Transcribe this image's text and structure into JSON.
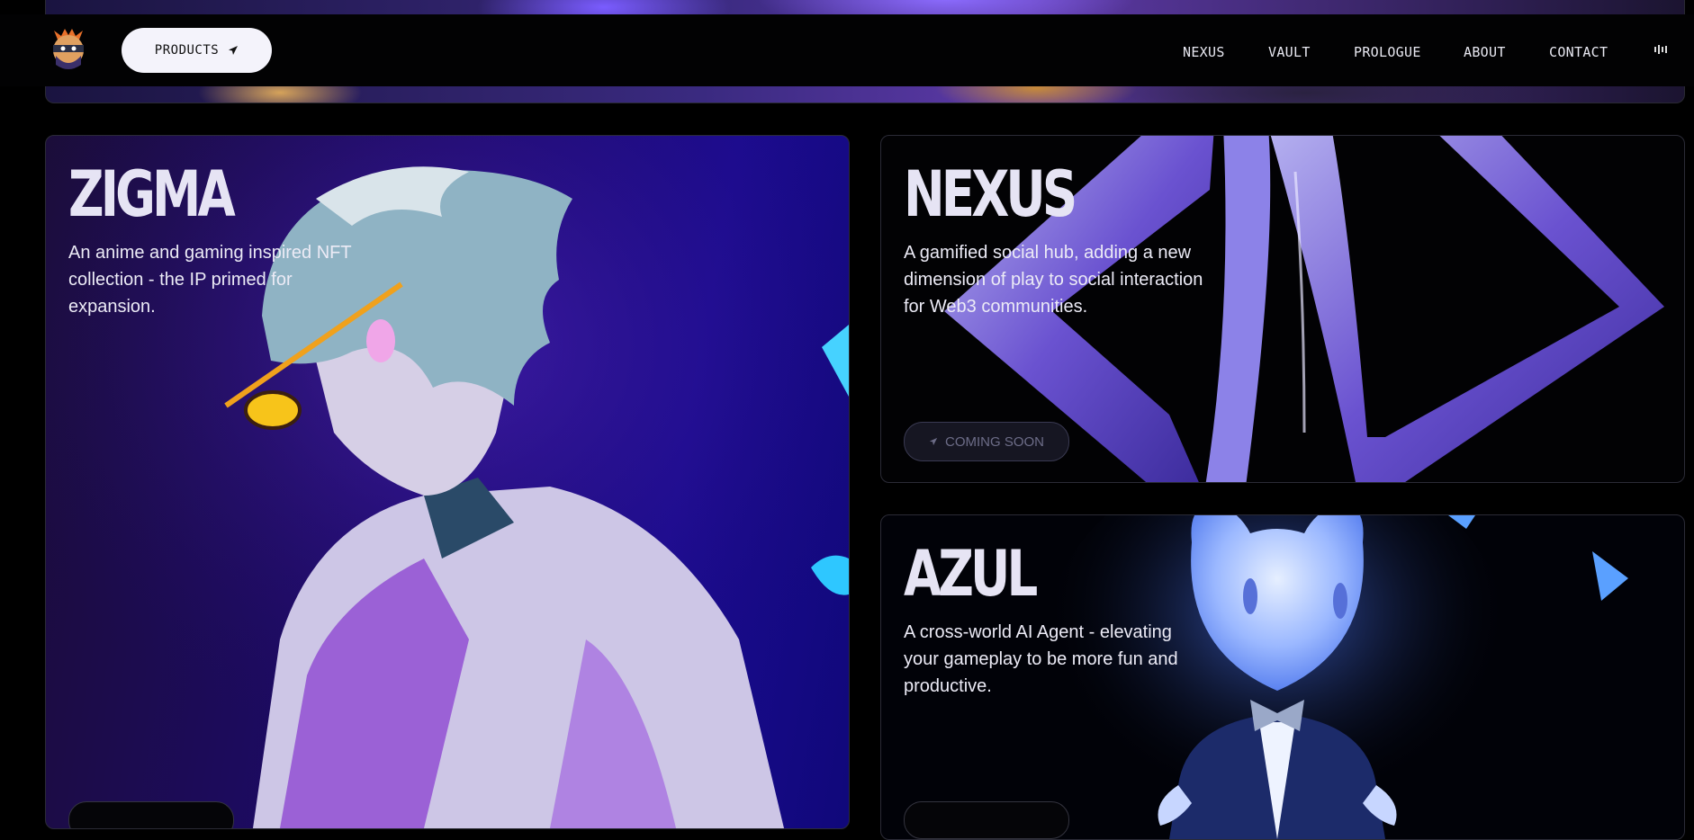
{
  "navbar": {
    "logo_icon": "ninja-mascot-logo-icon",
    "products_label": "PRODUCTS",
    "products_icon": "paper-plane-icon",
    "links": [
      {
        "label": "NEXUS"
      },
      {
        "label": "VAULT"
      },
      {
        "label": "PROLOGUE"
      },
      {
        "label": "ABOUT"
      },
      {
        "label": "CONTACT"
      }
    ],
    "audio_icon": "audio-bars-icon"
  },
  "cards": {
    "zigma": {
      "title": "ZIGMA",
      "description": "An anime and gaming inspired NFT collection - the IP primed for expansion.",
      "art": "anime-character-with-sunglasses"
    },
    "nexus": {
      "title": "NEXUS",
      "description": "A gamified social hub, adding a new dimension of play to social interaction for Web3 communities.",
      "badge": "COMING SOON",
      "badge_icon": "paper-plane-icon",
      "art": "chrome-nexus-logo"
    },
    "azul": {
      "title": "AZUL",
      "description": "A cross-world AI Agent - elevating your gameplay to be more fun and productive.",
      "art": "glowing-blue-spirit-character"
    }
  },
  "colors": {
    "background": "#000000",
    "products_button": "#f4f3fb",
    "title_text": "#e6e4f4",
    "zigma_bg": "#1d0a6a",
    "azul_glow": "#4f7bff"
  }
}
